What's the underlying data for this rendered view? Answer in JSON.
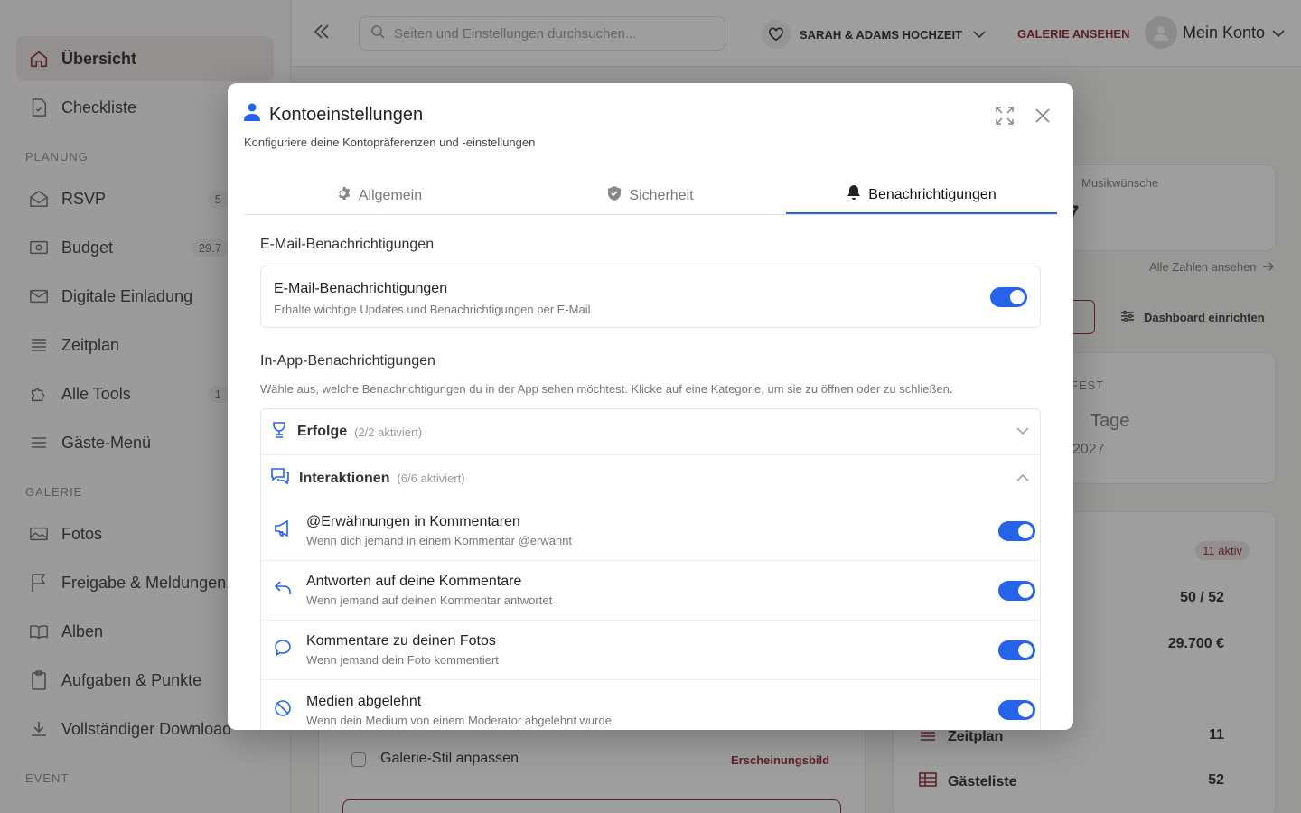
{
  "sidebar": {
    "items_top": [
      {
        "label": "Übersicht",
        "icon": "home-icon"
      },
      {
        "label": "Checkliste",
        "icon": "checklist-icon"
      }
    ],
    "sections": [
      {
        "title": "PLANUNG",
        "items": [
          {
            "label": "RSVP",
            "badge": "5",
            "icon": "envelope-open-icon"
          },
          {
            "label": "Budget",
            "badge": "29.7",
            "icon": "money-icon"
          },
          {
            "label": "Digitale Einladung",
            "badge": "",
            "icon": "mail-icon"
          },
          {
            "label": "Zeitplan",
            "badge": "",
            "icon": "list-icon"
          },
          {
            "label": "Alle Tools",
            "badge": "1",
            "icon": "puzzle-icon"
          },
          {
            "label": "Gäste-Menü",
            "badge": "",
            "icon": "menu-icon"
          }
        ]
      },
      {
        "title": "GALERIE",
        "items": [
          {
            "label": "Fotos",
            "badge": "",
            "icon": "photo-icon"
          },
          {
            "label": "Freigabe & Meldungen",
            "badge": "",
            "icon": "flag-icon"
          },
          {
            "label": "Alben",
            "badge": "",
            "icon": "book-icon"
          },
          {
            "label": "Aufgaben & Punkte",
            "badge": "",
            "icon": "clipboard-icon"
          },
          {
            "label": "Vollständiger Download",
            "badge": "",
            "icon": "download-icon"
          }
        ]
      },
      {
        "title": "EVENT",
        "items": []
      }
    ]
  },
  "topbar": {
    "search_placeholder": "Seiten und Einstellungen durchsuchen...",
    "event_name": "SARAH & ADAMS HOCHZEIT",
    "gallery_link": "GALERIE ANSEHEN",
    "account": "Mein Konto"
  },
  "background": {
    "music_label": "Musikwünsche",
    "music_value": "7",
    "all_numbers": "Alle Zahlen ansehen",
    "dashboard_btn": "Dashboard einrichten",
    "countdown_label": "FEST",
    "countdown_unit": "Tage",
    "countdown_year": "2027",
    "active_badge": "11 aktiv",
    "rows": [
      {
        "label": "",
        "value": "50 / 52"
      },
      {
        "label": "",
        "value": "29.700 €"
      },
      {
        "label": "",
        "value": ""
      },
      {
        "label": "Zeitplan",
        "value": "11"
      },
      {
        "label": "Gästeliste",
        "value": "52"
      }
    ],
    "task_label": "Galerie-Stil anpassen",
    "task_tag": "Erscheinungsbild"
  },
  "modal": {
    "title": "Kontoeinstellungen",
    "subtitle": "Konfiguriere deine Kontopräferenzen und -einstellungen",
    "tabs": [
      {
        "label": "Allgemein",
        "icon": "gear-icon",
        "active": false
      },
      {
        "label": "Sicherheit",
        "icon": "shield-icon",
        "active": false
      },
      {
        "label": "Benachrichtigungen",
        "icon": "bell-icon",
        "active": true
      }
    ],
    "email_section_title": "E-Mail-Benachrichtigungen",
    "email_setting": {
      "name": "E-Mail-Benachrichtigungen",
      "desc": "Erhalte wichtige Updates und Benachrichtigungen per E-Mail",
      "enabled": true
    },
    "inapp_section_title": "In-App-Benachrichtigungen",
    "inapp_desc": "Wähle aus, welche Benachrichtigungen du in der App sehen möchtest. Klicke auf eine Kategorie, um sie zu öffnen oder zu schließen.",
    "categories": [
      {
        "name": "Erfolge",
        "count": "(2/2 aktiviert)",
        "expanded": false,
        "icon": "trophy-icon"
      },
      {
        "name": "Interaktionen",
        "count": "(6/6 aktiviert)",
        "expanded": true,
        "icon": "chat-icon"
      }
    ],
    "interaction_items": [
      {
        "name": "@Erwähnungen in Kommentaren",
        "desc": "Wenn dich jemand in einem Kommentar @erwähnt",
        "icon": "megaphone-icon",
        "enabled": true
      },
      {
        "name": "Antworten auf deine Kommentare",
        "desc": "Wenn jemand auf deinen Kommentar antwortet",
        "icon": "reply-icon",
        "enabled": true
      },
      {
        "name": "Kommentare zu deinen Fotos",
        "desc": "Wenn jemand dein Foto kommentiert",
        "icon": "comment-icon",
        "enabled": true
      },
      {
        "name": "Medien abgelehnt",
        "desc": "Wenn dein Medium von einem Moderator abgelehnt wurde",
        "icon": "ban-icon",
        "enabled": true
      }
    ]
  },
  "colors": {
    "accent": "#2563eb",
    "brand": "#8b1c2c"
  }
}
